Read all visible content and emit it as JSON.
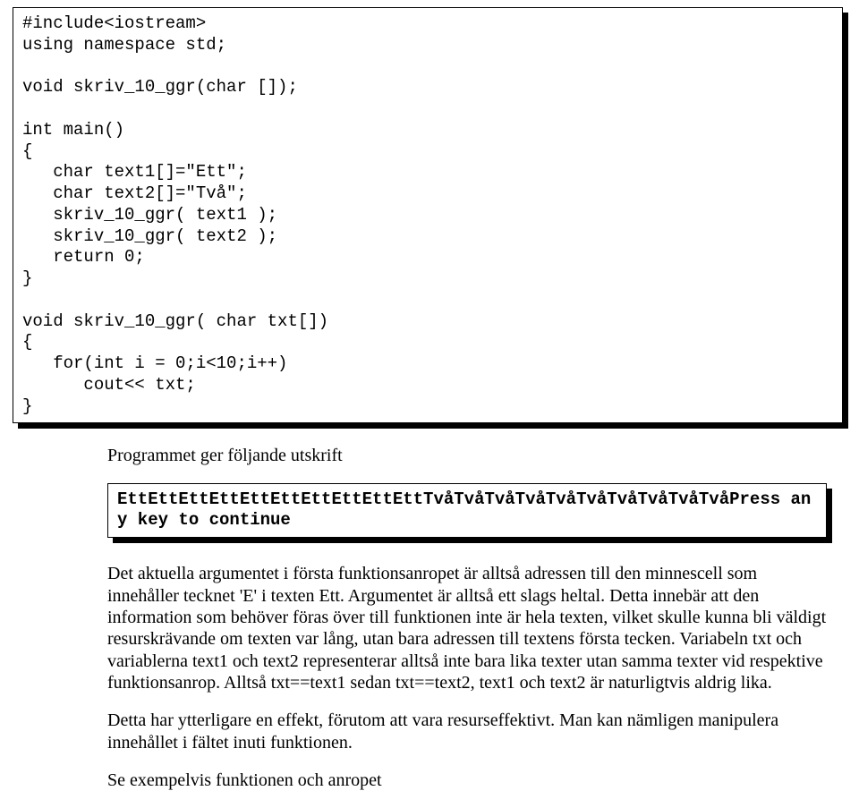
{
  "code": {
    "lines": "#include<iostream>\nusing namespace std;\n\nvoid skriv_10_ggr(char []);\n\nint main()\n{\n   char text1[]=\"Ett\";\n   char text2[]=\"Två\";\n   skriv_10_ggr( text1 );\n   skriv_10_ggr( text2 );\n   return 0;\n}\n\nvoid skriv_10_ggr( char txt[])\n{\n   for(int i = 0;i<10;i++)\n      cout<< txt;\n}"
  },
  "output_caption": "Programmet ger följande utskrift",
  "output": {
    "text": "EttEttEttEttEttEttEttEttEttEttTvåTvåTvåTvåTvåTvåTvåTvåTvåTvåPress any key to continue"
  },
  "paragraphs": {
    "p1": "Det aktuella argumentet i första funktionsanropet är alltså adressen till den minnescell som innehåller tecknet 'E' i texten Ett. Argumentet är alltså ett slags heltal. Detta innebär att den information som behöver föras över till funktionen inte är hela texten, vilket skulle kunna bli väldigt resurskrävande om texten var lång, utan bara adressen till textens första tecken. Variabeln txt och variablerna text1 och text2 representerar alltså inte bara lika texter utan samma texter vid respektive funktionsanrop. Alltså txt==text1 sedan txt==text2, text1 och text2 är naturligtvis aldrig lika.",
    "p2": "Detta har ytterligare en effekt, förutom att vara resurseffektivt. Man kan nämligen manipulera innehållet i fältet inuti funktionen.",
    "p3": "Se exempelvis funktionen och anropet"
  }
}
